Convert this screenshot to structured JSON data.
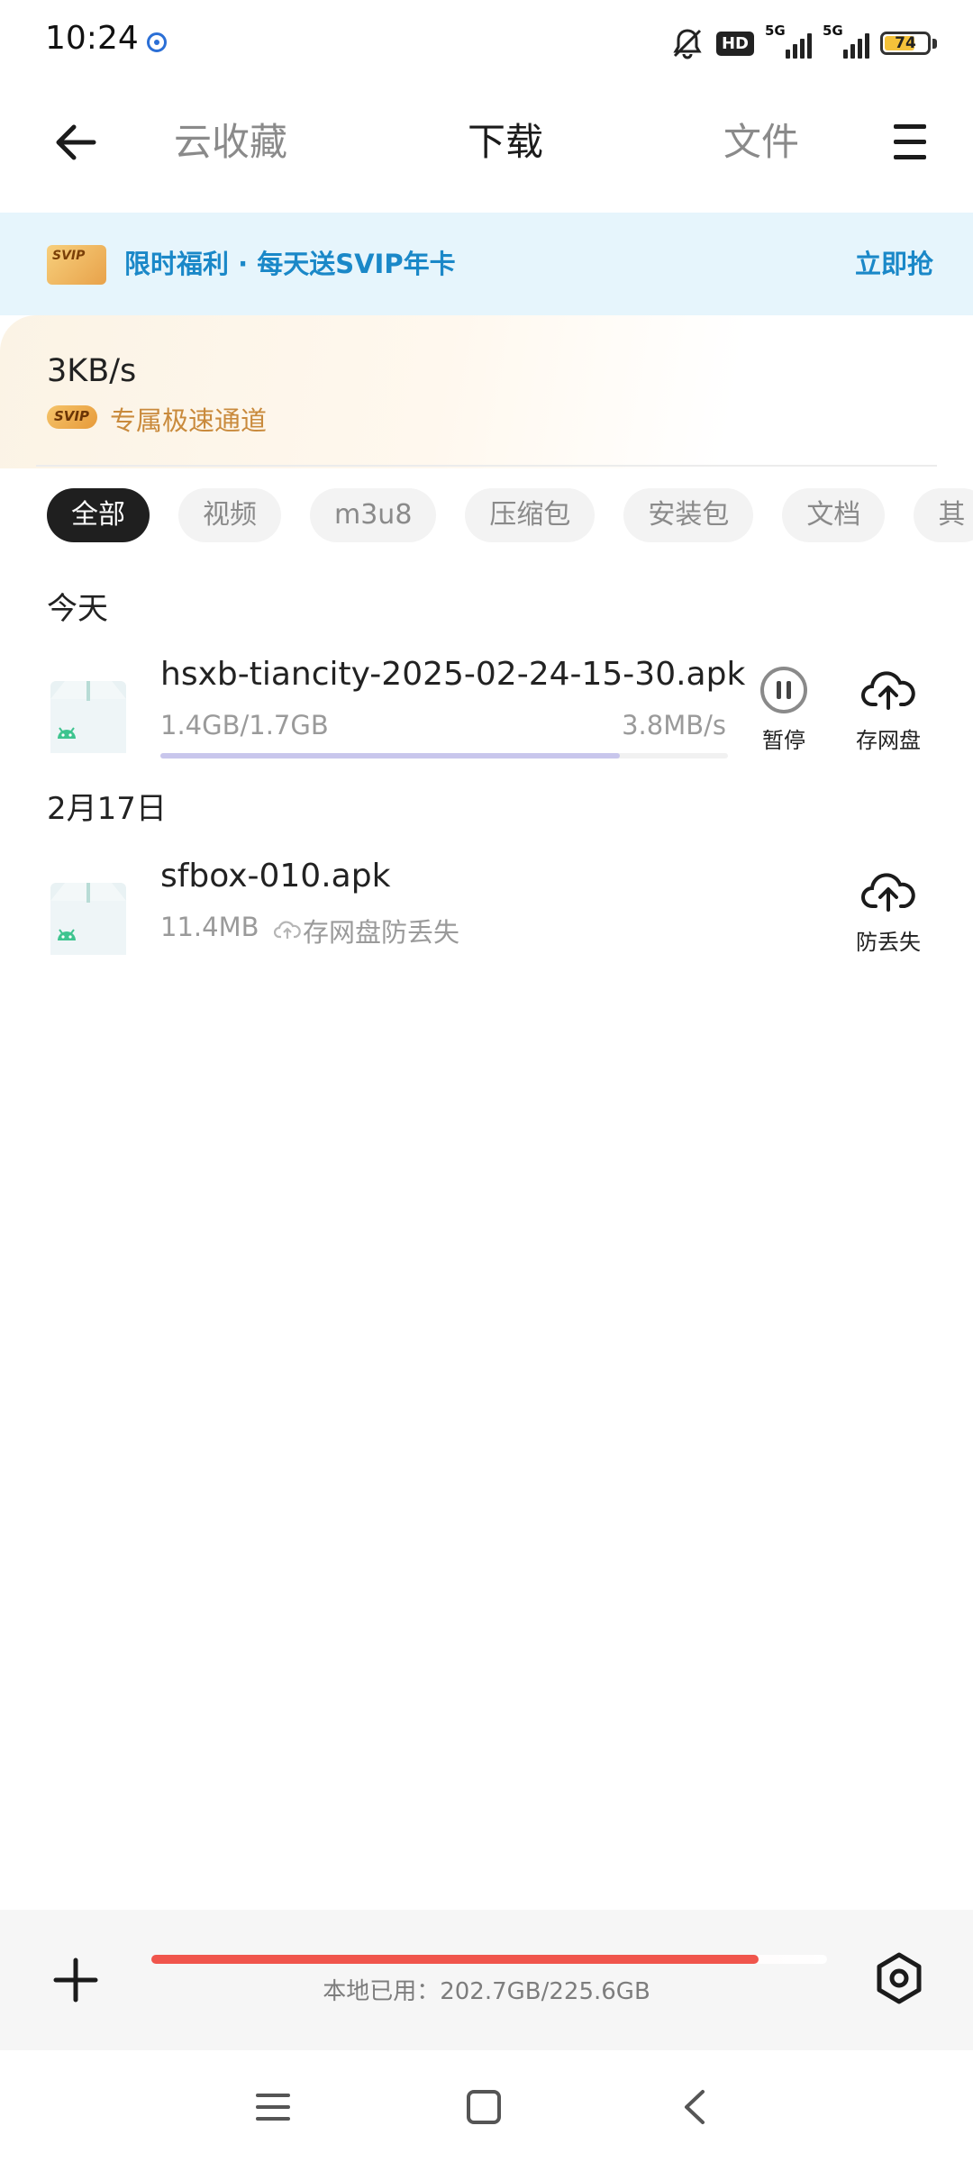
{
  "status_bar": {
    "time": "10:24",
    "hd_label": "HD",
    "network_1": "5G",
    "network_2": "5G",
    "battery": "74",
    "battery_level": 0.74,
    "battery_color": "#f4c23a"
  },
  "nav": {
    "tabs": [
      {
        "label": "云收藏",
        "active": false
      },
      {
        "label": "下载",
        "active": true
      },
      {
        "label": "文件",
        "active": false
      }
    ],
    "back_icon": "arrow-left-icon",
    "menu_icon": "menu-icon"
  },
  "banner": {
    "card_text": "SVIP",
    "text": "限时福利 · 每天送SVIP年卡",
    "action": "立即抢",
    "color": "#1a88c8"
  },
  "speed": {
    "value": "3KB/s",
    "badge": "SVIP",
    "subtitle": "专属极速通道"
  },
  "filters": [
    "全部",
    "视频",
    "m3u8",
    "压缩包",
    "安装包",
    "文档",
    "其"
  ],
  "sections": [
    {
      "label": "今天",
      "items": [
        {
          "name": "hsxb-tiancity-2025-02-24-15-30.apk",
          "size": "1.4GB/1.7GB",
          "speed": "3.8MB/s",
          "progress": 0.81,
          "actions": [
            {
              "label": "暂停",
              "icon": "pause-icon"
            },
            {
              "label": "存网盘",
              "icon": "cloud-upload-icon"
            }
          ]
        }
      ]
    },
    {
      "label": "2月17日",
      "items": [
        {
          "name": "sfbox-010.apk",
          "size": "11.4MB",
          "note": "存网盘防丢失",
          "actions": [
            {
              "label": "防丢失",
              "icon": "cloud-upload-icon"
            }
          ]
        }
      ]
    }
  ],
  "bottom": {
    "storage_label": "本地已用：202.7GB/225.6GB",
    "storage_used": 0.898,
    "storage_color": "#f0554c",
    "add_icon": "plus-icon",
    "settings_icon": "settings-hex-icon"
  },
  "system_nav": [
    "recent-apps-icon",
    "home-icon",
    "back-icon"
  ]
}
